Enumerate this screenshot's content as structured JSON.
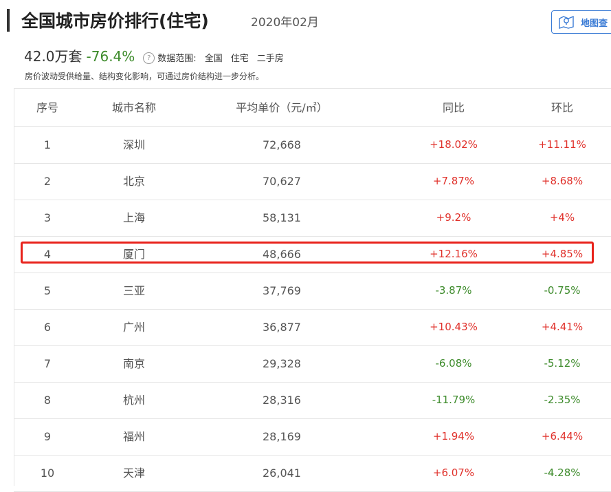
{
  "header": {
    "title": "全国城市房价排行(住宅)",
    "date": "2020年02月",
    "map_button_label": "地图查"
  },
  "summary": {
    "count": "42.0万套",
    "change": "-76.4%",
    "help_icon_glyph": "?",
    "scope_label": "数据范围:",
    "scope_items": [
      "全国",
      "住宅",
      "二手房"
    ],
    "note": "房价波动受供给量、结构变化影响，可通过房价结构进一步分析。"
  },
  "table": {
    "columns": [
      "序号",
      "城市名称",
      "平均单价（元/㎡）",
      "同比",
      "环比"
    ],
    "rows": [
      {
        "rank": "1",
        "city": "深圳",
        "price": "72,668",
        "yoy": "+18.02%",
        "mom": "+11.11%"
      },
      {
        "rank": "2",
        "city": "北京",
        "price": "70,627",
        "yoy": "+7.87%",
        "mom": "+8.68%"
      },
      {
        "rank": "3",
        "city": "上海",
        "price": "58,131",
        "yoy": "+9.2%",
        "mom": "+4%"
      },
      {
        "rank": "4",
        "city": "厦门",
        "price": "48,666",
        "yoy": "+12.16%",
        "mom": "+4.85%"
      },
      {
        "rank": "5",
        "city": "三亚",
        "price": "37,769",
        "yoy": "-3.87%",
        "mom": "-0.75%"
      },
      {
        "rank": "6",
        "city": "广州",
        "price": "36,877",
        "yoy": "+10.43%",
        "mom": "+4.41%"
      },
      {
        "rank": "7",
        "city": "南京",
        "price": "29,328",
        "yoy": "-6.08%",
        "mom": "-5.12%"
      },
      {
        "rank": "8",
        "city": "杭州",
        "price": "28,316",
        "yoy": "-11.79%",
        "mom": "-2.35%"
      },
      {
        "rank": "9",
        "city": "福州",
        "price": "28,169",
        "yoy": "+1.94%",
        "mom": "+6.44%"
      },
      {
        "rank": "10",
        "city": "天津",
        "price": "26,041",
        "yoy": "+6.07%",
        "mom": "-4.28%"
      }
    ]
  },
  "colors": {
    "positive": "#e0312b",
    "negative": "#3d8b2b",
    "highlight_border": "#e8221b",
    "accent": "#3a7bd5"
  }
}
